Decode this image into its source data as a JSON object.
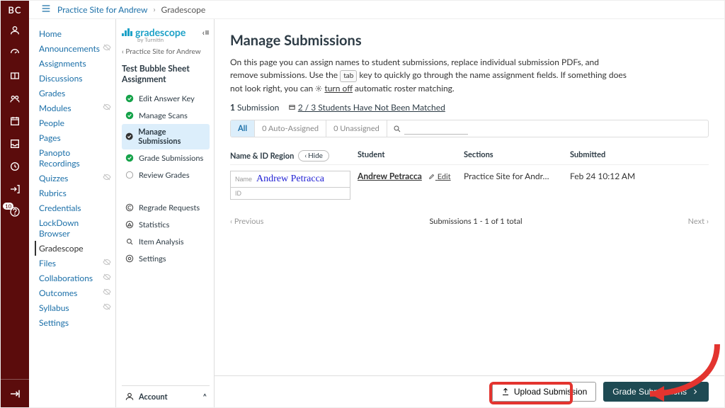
{
  "global_nav": {
    "logo": "BC",
    "badge": "10"
  },
  "breadcrumb": {
    "course": "Practice Site for Andrew",
    "leaf": "Gradescope"
  },
  "course_nav": {
    "items": [
      {
        "label": "Home",
        "hidden": false
      },
      {
        "label": "Announcements",
        "hidden": true
      },
      {
        "label": "Assignments",
        "hidden": false
      },
      {
        "label": "Discussions",
        "hidden": false
      },
      {
        "label": "Grades",
        "hidden": false
      },
      {
        "label": "Modules",
        "hidden": true
      },
      {
        "label": "People",
        "hidden": false
      },
      {
        "label": "Pages",
        "hidden": false
      },
      {
        "label": "Panopto Recordings",
        "hidden": false
      },
      {
        "label": "Quizzes",
        "hidden": true
      },
      {
        "label": "Rubrics",
        "hidden": false
      },
      {
        "label": "Credentials",
        "hidden": false
      },
      {
        "label": "LockDown Browser",
        "hidden": false
      },
      {
        "label": "Gradescope",
        "hidden": false,
        "active": true
      },
      {
        "label": "Files",
        "hidden": true
      },
      {
        "label": "Collaborations",
        "hidden": true
      },
      {
        "label": "Outcomes",
        "hidden": true
      },
      {
        "label": "Syllabus",
        "hidden": true
      },
      {
        "label": "Settings",
        "hidden": false
      }
    ]
  },
  "gs": {
    "brand": "gradescope",
    "brand_sub": "by Turnitin",
    "back": "Practice Site for Andrew",
    "assignment_name": "Test Bubble Sheet Assignment",
    "steps": [
      {
        "label": "Edit Answer Key",
        "state": "done"
      },
      {
        "label": "Manage Scans",
        "state": "done"
      },
      {
        "label": "Manage Submissions",
        "state": "current"
      },
      {
        "label": "Grade Submissions",
        "state": "done"
      },
      {
        "label": "Review Grades",
        "state": "pending"
      }
    ],
    "more": [
      {
        "label": "Regrade Requests",
        "letter": "C"
      },
      {
        "label": "Statistics",
        "letter": "▲"
      },
      {
        "label": "Item Analysis",
        "letter": "Q"
      },
      {
        "label": "Settings",
        "letter": "⚙"
      }
    ],
    "account": "Account"
  },
  "page": {
    "title": "Manage Submissions",
    "desc_a": "On this page you can assign names to student submissions, replace individual submission PDFs, and remove submissions. Use the ",
    "kbd": "tab",
    "desc_b": " key to quickly go through the name assignment fields. If something does not look right, you can ",
    "turnoff": "turn off",
    "desc_c": " automatic roster matching.",
    "submission_count": "1",
    "submission_word": " Submission",
    "unmatched_warn": "2 / 3 Students Have Not Been Matched",
    "tabs": {
      "all": "All",
      "auto": "0 Auto-Assigned",
      "un": "0 Unassigned"
    },
    "headers": {
      "name_region": "Name & ID Region",
      "hide": "Hide",
      "student": "Student",
      "sections": "Sections",
      "submitted": "Submitted"
    },
    "row": {
      "name_label": "Name",
      "hand_name": "Andrew  Petracca",
      "id_label": "ID",
      "student": "Andrew Petracca",
      "edit": "Edit",
      "section": "Practice Site for Andr…",
      "submitted": "Feb 24 10:12 AM"
    },
    "pager": {
      "prev": "Previous",
      "mid": "Submissions 1 - 1 of 1 total",
      "next": "Next"
    },
    "buttons": {
      "upload": "Upload Submission",
      "grade": "Grade Submissions"
    }
  }
}
